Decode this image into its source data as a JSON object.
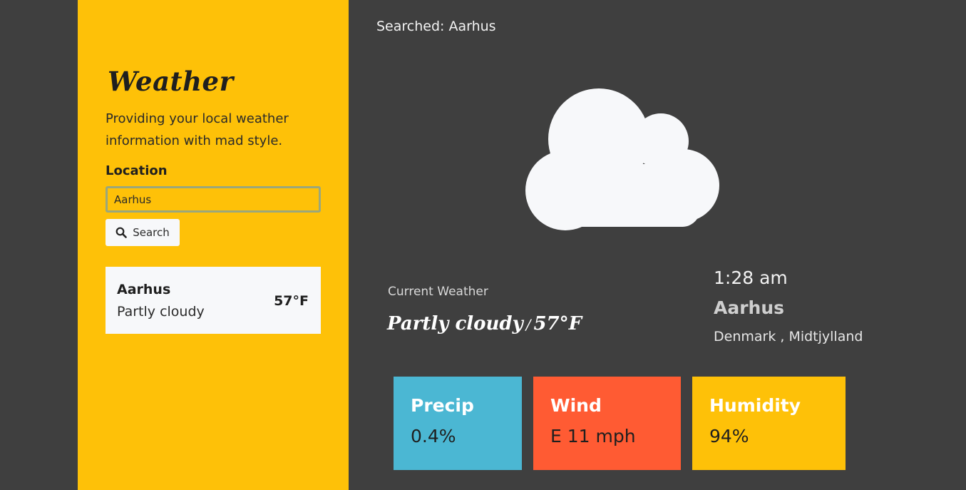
{
  "sidebar": {
    "title": "Weather",
    "tagline": "Providing your local weather information with mad style.",
    "location_label": "Location",
    "location_value": "Aarhus",
    "search_label": "Search",
    "search_icon": "search-icon",
    "result": {
      "city": "Aarhus",
      "condition": "Partly cloudy",
      "temp": "57°F"
    }
  },
  "main": {
    "searched": "Searched: Aarhus",
    "icon": "cloud-icon",
    "current_label": "Current Weather",
    "condition": "Partly cloudy",
    "separator": "/",
    "temp": "57°F",
    "time": "1:28 am",
    "city": "Aarhus",
    "region": "Denmark , Midtjylland"
  },
  "stats": [
    {
      "title": "Precip",
      "value": "0.4%",
      "color": "#4bb7d3"
    },
    {
      "title": "Wind",
      "value": "E 11 mph",
      "color": "#ff5b33"
    },
    {
      "title": "Humidity",
      "value": "94%",
      "color": "#fec108"
    }
  ],
  "colors": {
    "background": "#3f3f3f",
    "accent_yellow": "#fec108",
    "card": "#f7f8fa"
  }
}
